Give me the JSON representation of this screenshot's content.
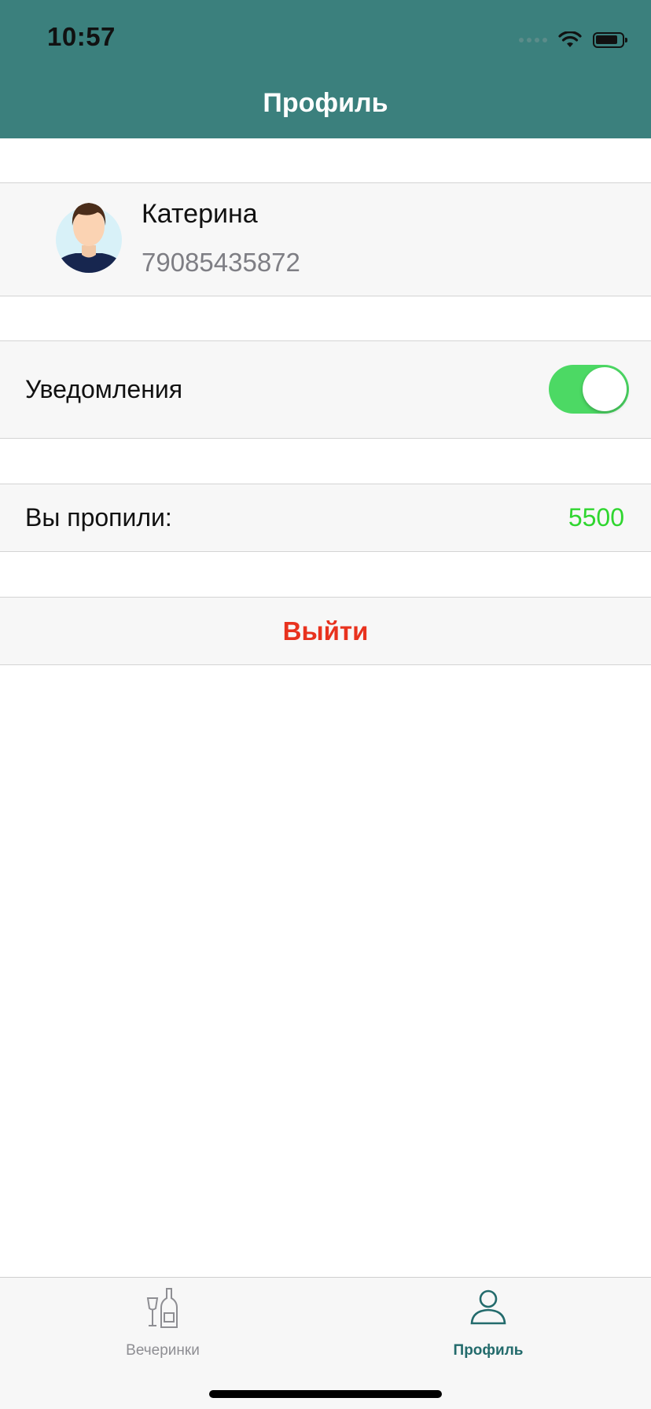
{
  "status_bar": {
    "time": "10:57"
  },
  "navbar": {
    "title": "Профиль",
    "background": "#3b807d"
  },
  "profile": {
    "name": "Катерина",
    "phone": "79085435872"
  },
  "notifications": {
    "label": "Уведомления",
    "enabled": true,
    "toggle_color": "#4cd964"
  },
  "drinks": {
    "label": "Вы пропили:",
    "value": "5500",
    "value_color": "#2fd62f"
  },
  "logout": {
    "label": "Выйти",
    "color": "#e8321e"
  },
  "tabbar": {
    "tabs": [
      {
        "label": "Вечеринки",
        "icon": "bottles-icon",
        "selected": false
      },
      {
        "label": "Профиль",
        "icon": "person-icon",
        "selected": true
      }
    ]
  }
}
